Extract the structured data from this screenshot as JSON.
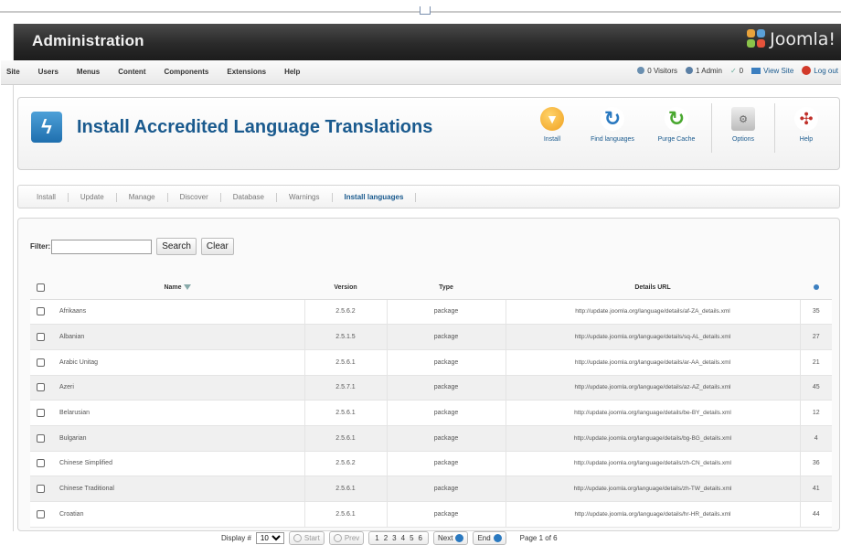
{
  "header": {
    "title": "Administration",
    "logo_text": "Joomla!"
  },
  "menu": {
    "items": [
      "Site",
      "Users",
      "Menus",
      "Content",
      "Components",
      "Extensions",
      "Help"
    ],
    "visitors": "0 Visitors",
    "admins": "1 Admin",
    "messages": "0",
    "view_site": "View Site",
    "logout": "Log out"
  },
  "toolbar": {
    "page_title": "Install Accredited Language Translations",
    "buttons": {
      "install": "Install",
      "find": "Find languages",
      "purge": "Purge Cache",
      "options": "Options",
      "help": "Help"
    }
  },
  "subnav": {
    "tabs": [
      "Install",
      "Update",
      "Manage",
      "Discover",
      "Database",
      "Warnings",
      "Install languages"
    ],
    "active": "Install languages"
  },
  "filter": {
    "label": "Filter:",
    "value": "",
    "search_label": "Search",
    "clear_label": "Clear"
  },
  "table": {
    "headers": {
      "name": "Name",
      "version": "Version",
      "type": "Type",
      "url": "Details URL"
    },
    "rows": [
      {
        "name": "Afrikaans",
        "version": "2.5.6.2",
        "type": "package",
        "url": "http://update.joomla.org/language/details/af-ZA_details.xml",
        "id": "35"
      },
      {
        "name": "Albanian",
        "version": "2.5.1.5",
        "type": "package",
        "url": "http://update.joomla.org/language/details/sq-AL_details.xml",
        "id": "27"
      },
      {
        "name": "Arabic Unitag",
        "version": "2.5.6.1",
        "type": "package",
        "url": "http://update.joomla.org/language/details/ar-AA_details.xml",
        "id": "21"
      },
      {
        "name": "Azeri",
        "version": "2.5.7.1",
        "type": "package",
        "url": "http://update.joomla.org/language/details/az-AZ_details.xml",
        "id": "45"
      },
      {
        "name": "Belarusian",
        "version": "2.5.6.1",
        "type": "package",
        "url": "http://update.joomla.org/language/details/be-BY_details.xml",
        "id": "12"
      },
      {
        "name": "Bulgarian",
        "version": "2.5.6.1",
        "type": "package",
        "url": "http://update.joomla.org/language/details/bg-BG_details.xml",
        "id": "4"
      },
      {
        "name": "Chinese Simplified",
        "version": "2.5.6.2",
        "type": "package",
        "url": "http://update.joomla.org/language/details/zh-CN_details.xml",
        "id": "36"
      },
      {
        "name": "Chinese Traditional",
        "version": "2.5.6.1",
        "type": "package",
        "url": "http://update.joomla.org/language/details/zh-TW_details.xml",
        "id": "41"
      },
      {
        "name": "Croatian",
        "version": "2.5.6.1",
        "type": "package",
        "url": "http://update.joomla.org/language/details/hr-HR_details.xml",
        "id": "44"
      }
    ]
  },
  "pagination": {
    "display_label": "Display #",
    "display_value": "10",
    "start": "Start",
    "prev": "Prev",
    "pages": [
      "1",
      "2",
      "3",
      "4",
      "5",
      "6"
    ],
    "next": "Next",
    "end": "End",
    "page_info": "Page 1 of 6"
  },
  "colors": {
    "brand_blue": "#1a5a8e",
    "install_orange": "#f0a020",
    "find_blue": "#2a79c0",
    "purge_green": "#4aa830",
    "help_red": "#c0302a"
  }
}
